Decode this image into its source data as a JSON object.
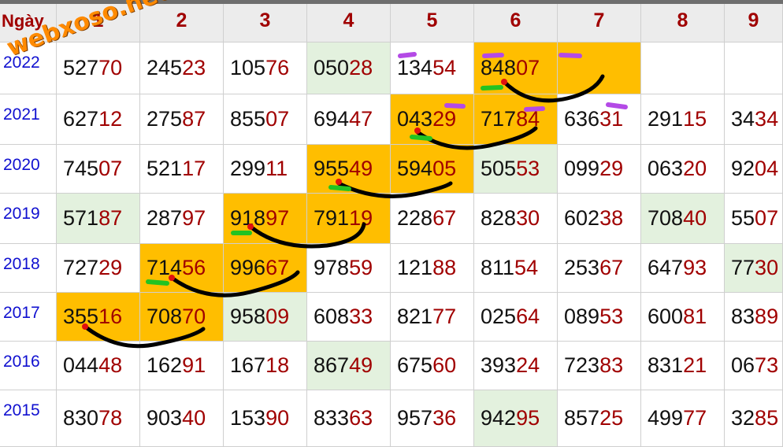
{
  "header": {
    "corner": "Ngày",
    "columns": [
      "1",
      "2",
      "3",
      "4",
      "5",
      "6",
      "7",
      "8",
      "9"
    ]
  },
  "rows": [
    {
      "year": "2022",
      "cells": [
        "52770",
        "24523",
        "10576",
        "05028",
        "13454",
        "84807",
        "",
        "",
        ""
      ]
    },
    {
      "year": "2021",
      "cells": [
        "62712",
        "27587",
        "85507",
        "69447",
        "04329",
        "71784",
        "63631",
        "29115",
        "3434"
      ]
    },
    {
      "year": "2020",
      "cells": [
        "74507",
        "52117",
        "29911",
        "95549",
        "59405",
        "50553",
        "09929",
        "06320",
        "9204"
      ]
    },
    {
      "year": "2019",
      "cells": [
        "57187",
        "28797",
        "91897",
        "79119",
        "22867",
        "82830",
        "60238",
        "70840",
        "5507"
      ]
    },
    {
      "year": "2018",
      "cells": [
        "72729",
        "71456",
        "99667",
        "97859",
        "12188",
        "81154",
        "25367",
        "64793",
        "7730"
      ]
    },
    {
      "year": "2017",
      "cells": [
        "35516",
        "70870",
        "95809",
        "60833",
        "82177",
        "02564",
        "08953",
        "60081",
        "8389"
      ]
    },
    {
      "year": "2016",
      "cells": [
        "04448",
        "16291",
        "16718",
        "86749",
        "67560",
        "39324",
        "72383",
        "83121",
        "0673"
      ]
    },
    {
      "year": "2015",
      "cells": [
        "83078",
        "90340",
        "15390",
        "83363",
        "95736",
        "94295",
        "85725",
        "49977",
        "3285"
      ]
    }
  ],
  "highlights": {
    "gold": [
      [
        0,
        5
      ],
      [
        0,
        6
      ],
      [
        1,
        4
      ],
      [
        1,
        5
      ],
      [
        2,
        3
      ],
      [
        2,
        4
      ],
      [
        3,
        2
      ],
      [
        3,
        3
      ],
      [
        4,
        1
      ],
      [
        4,
        2
      ],
      [
        5,
        0
      ],
      [
        5,
        1
      ]
    ],
    "green": [
      [
        0,
        3
      ],
      [
        2,
        5
      ],
      [
        3,
        0
      ],
      [
        3,
        7
      ],
      [
        4,
        8
      ],
      [
        5,
        2
      ],
      [
        6,
        3
      ],
      [
        7,
        5
      ]
    ]
  },
  "watermark": "webxoso.net",
  "colors": {
    "gold": "#ffbe00",
    "green": "#e3f1de",
    "digits_tail": "#a00000",
    "year": "#1010d0",
    "header_bg": "#ececec"
  }
}
